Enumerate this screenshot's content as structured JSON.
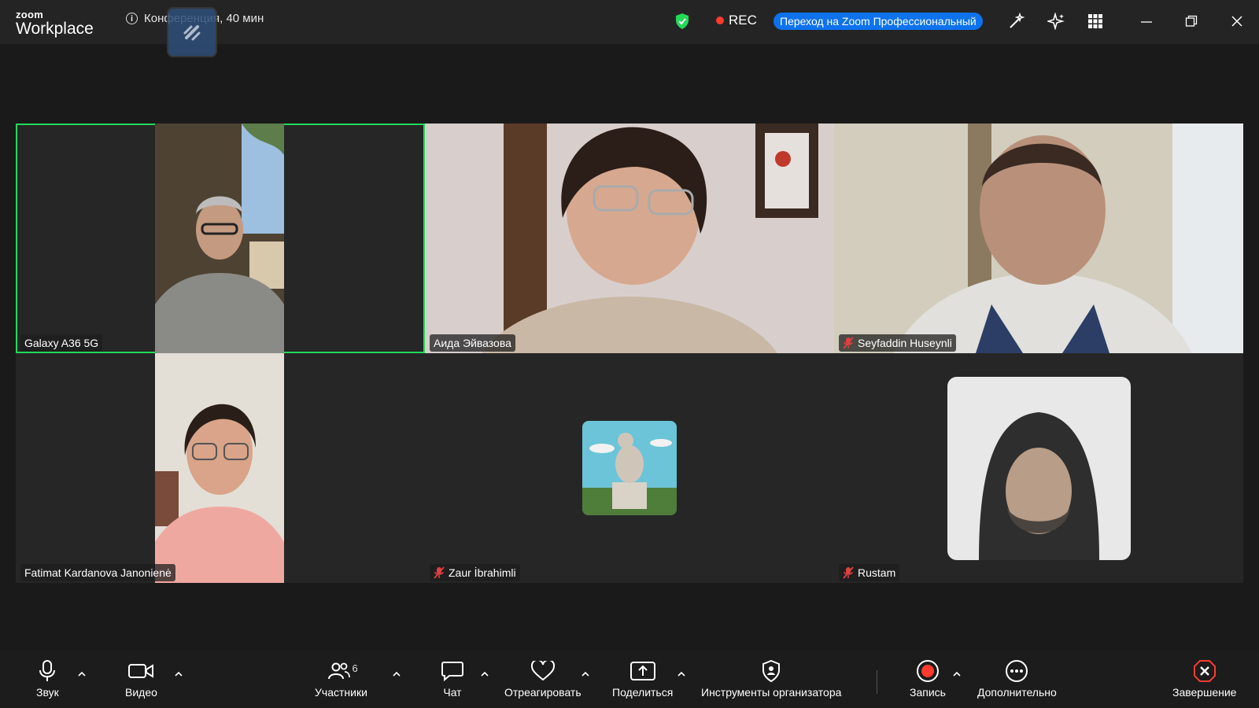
{
  "app": {
    "brand_small": "zoom",
    "brand_big": "Workplace"
  },
  "meeting": {
    "info_text": "Конференция, 40 мин",
    "rec_label": "REC",
    "upgrade_label": "Переход на Zoom Профессиональный"
  },
  "colors": {
    "active_border": "#23d959",
    "rec_red": "#ff3b30",
    "upgrade_blue": "#0e72ed",
    "shield_green": "#23d959"
  },
  "participants": [
    {
      "name": "Galaxy A36 5G",
      "muted": false,
      "active": true
    },
    {
      "name": "Аида Эйвазова",
      "muted": false,
      "active": false
    },
    {
      "name": "Seyfaddin Huseynli",
      "muted": true,
      "active": false
    },
    {
      "name": "Fatimat Kardanova Janonienė",
      "muted": false,
      "active": false
    },
    {
      "name": "Zaur İbrahimli",
      "muted": true,
      "active": false
    },
    {
      "name": "Rustam",
      "muted": true,
      "active": false
    }
  ],
  "toolbar": {
    "audio": "Звук",
    "video": "Видео",
    "participants": "Участники",
    "participants_count": "6",
    "chat": "Чат",
    "react": "Отреагировать",
    "share": "Поделиться",
    "host_tools": "Инструменты организатора",
    "record": "Запись",
    "more": "Дополнительно",
    "end": "Завершение"
  }
}
